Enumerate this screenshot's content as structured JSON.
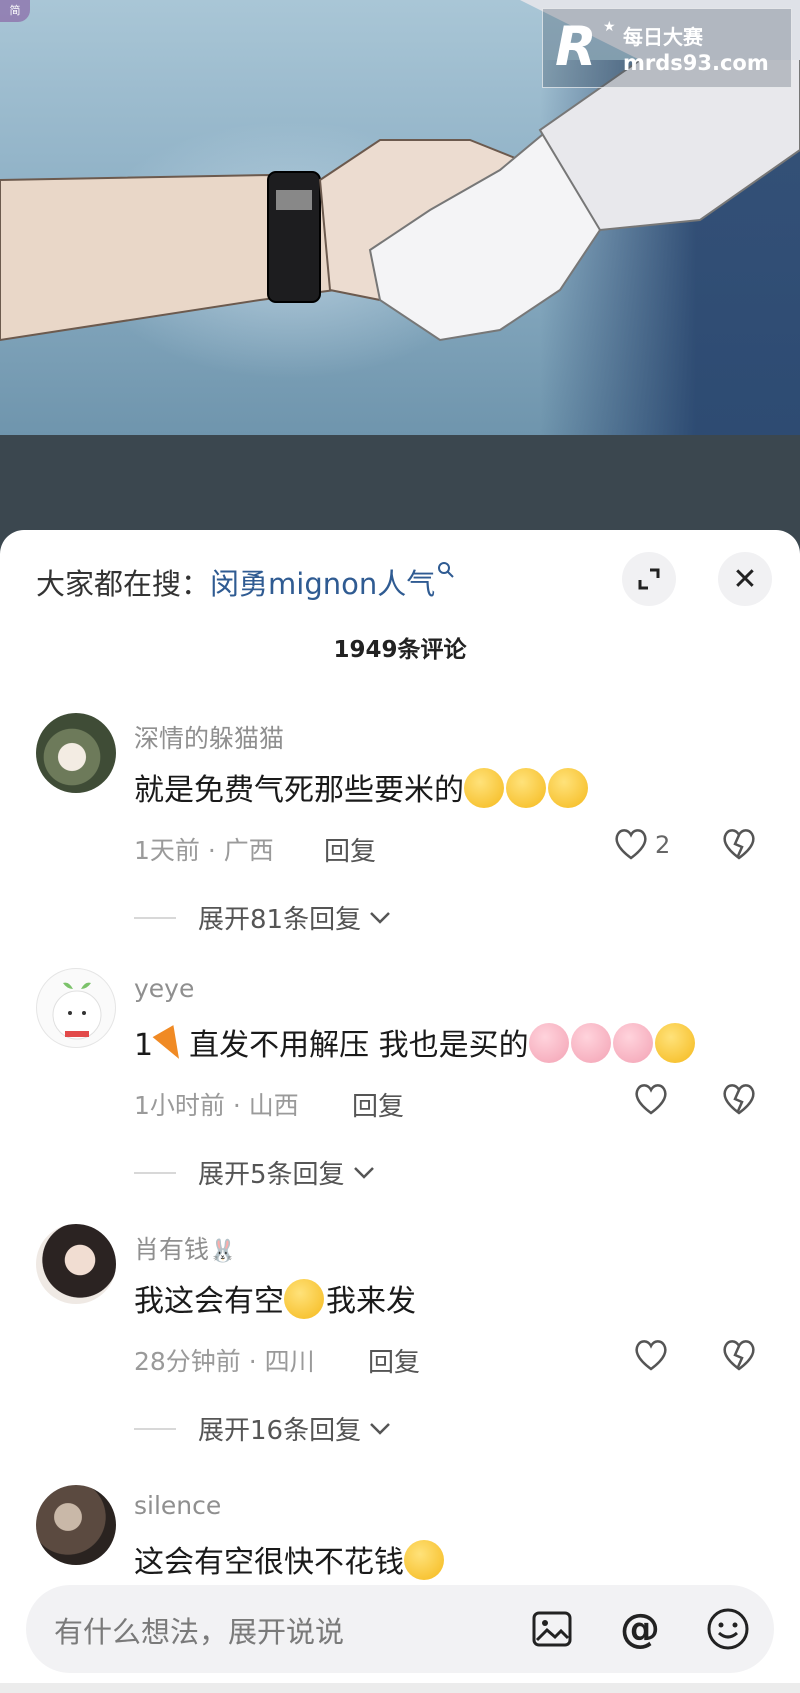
{
  "watermark": {
    "logo_letter": "R",
    "site_name": "每日大赛",
    "url": "mrds93.com"
  },
  "corner_badge": "简",
  "search": {
    "prefix": "大家都在搜：",
    "link": "闵勇mignon人气",
    "icon": "search-icon"
  },
  "header": {
    "comment_count": "1949条评论",
    "expand_icon": "expand-icon",
    "close_label": "✕"
  },
  "comments": [
    {
      "user": "深情的躲猫猫",
      "text_before": "就是免费气死那些要米的",
      "time_location": "1天前 · 广西",
      "reply": "回复",
      "likes": "2",
      "expand_text": "展开81条回复"
    },
    {
      "user": "yeye",
      "text_before": "1",
      "text_mid": "直发不用解压 我也是买的",
      "time_location": "1小时前 · 山西",
      "reply": "回复",
      "likes": "",
      "expand_text": "展开5条回复"
    },
    {
      "user": "肖有钱",
      "text_before": "我这会有空",
      "text_after": "我来发",
      "time_location": "28分钟前 · 四川",
      "reply": "回复",
      "likes": "",
      "expand_text": "展开16条回复"
    },
    {
      "user": "silence",
      "text_before": "这会有空很快不花钱"
    }
  ],
  "input": {
    "placeholder": "有什么想法，展开说说",
    "at_symbol": "@"
  }
}
